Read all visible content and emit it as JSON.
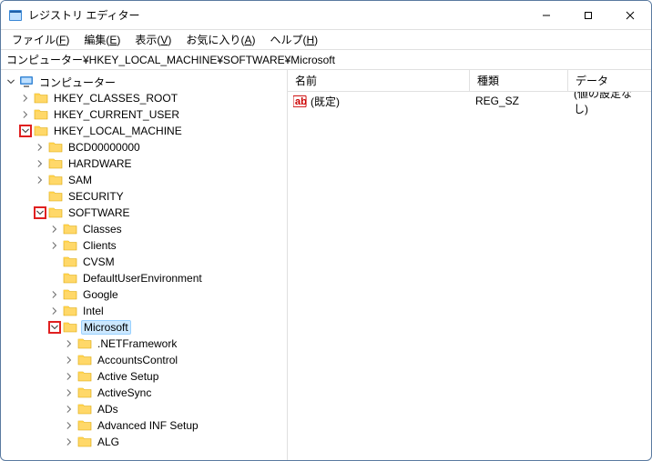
{
  "window": {
    "title": "レジストリ エディター"
  },
  "menu": {
    "file": {
      "label": "ファイル",
      "key": "F"
    },
    "edit": {
      "label": "編集",
      "key": "E"
    },
    "view": {
      "label": "表示",
      "key": "V"
    },
    "fav": {
      "label": "お気に入り",
      "key": "A"
    },
    "help": {
      "label": "ヘルプ",
      "key": "H"
    }
  },
  "address": "コンピューター¥HKEY_LOCAL_MACHINE¥SOFTWARE¥Microsoft",
  "tree": [
    {
      "indent": 0,
      "expander": "open",
      "highlight": false,
      "icon": "computer",
      "label": "コンピューター"
    },
    {
      "indent": 1,
      "expander": "closed",
      "highlight": false,
      "icon": "folder",
      "label": "HKEY_CLASSES_ROOT"
    },
    {
      "indent": 1,
      "expander": "closed",
      "highlight": false,
      "icon": "folder",
      "label": "HKEY_CURRENT_USER"
    },
    {
      "indent": 1,
      "expander": "open",
      "highlight": true,
      "icon": "folder",
      "label": "HKEY_LOCAL_MACHINE"
    },
    {
      "indent": 2,
      "expander": "closed",
      "highlight": false,
      "icon": "folder",
      "label": "BCD00000000"
    },
    {
      "indent": 2,
      "expander": "closed",
      "highlight": false,
      "icon": "folder",
      "label": "HARDWARE"
    },
    {
      "indent": 2,
      "expander": "closed",
      "highlight": false,
      "icon": "folder",
      "label": "SAM"
    },
    {
      "indent": 2,
      "expander": "none",
      "highlight": false,
      "icon": "folder",
      "label": "SECURITY"
    },
    {
      "indent": 2,
      "expander": "open",
      "highlight": true,
      "icon": "folder",
      "label": "SOFTWARE"
    },
    {
      "indent": 3,
      "expander": "closed",
      "highlight": false,
      "icon": "folder",
      "label": "Classes"
    },
    {
      "indent": 3,
      "expander": "closed",
      "highlight": false,
      "icon": "folder",
      "label": "Clients"
    },
    {
      "indent": 3,
      "expander": "none",
      "highlight": false,
      "icon": "folder",
      "label": "CVSM"
    },
    {
      "indent": 3,
      "expander": "none",
      "highlight": false,
      "icon": "folder",
      "label": "DefaultUserEnvironment"
    },
    {
      "indent": 3,
      "expander": "closed",
      "highlight": false,
      "icon": "folder",
      "label": "Google"
    },
    {
      "indent": 3,
      "expander": "closed",
      "highlight": false,
      "icon": "folder",
      "label": "Intel"
    },
    {
      "indent": 3,
      "expander": "open",
      "highlight": true,
      "icon": "folder",
      "label": "Microsoft",
      "selected": true
    },
    {
      "indent": 4,
      "expander": "closed",
      "highlight": false,
      "icon": "folder",
      "label": ".NETFramework"
    },
    {
      "indent": 4,
      "expander": "closed",
      "highlight": false,
      "icon": "folder",
      "label": "AccountsControl"
    },
    {
      "indent": 4,
      "expander": "closed",
      "highlight": false,
      "icon": "folder",
      "label": "Active Setup"
    },
    {
      "indent": 4,
      "expander": "closed",
      "highlight": false,
      "icon": "folder",
      "label": "ActiveSync"
    },
    {
      "indent": 4,
      "expander": "closed",
      "highlight": false,
      "icon": "folder",
      "label": "ADs"
    },
    {
      "indent": 4,
      "expander": "closed",
      "highlight": false,
      "icon": "folder",
      "label": "Advanced INF Setup"
    },
    {
      "indent": 4,
      "expander": "closed",
      "highlight": false,
      "icon": "folder",
      "label": "ALG"
    }
  ],
  "columns": {
    "name": "名前",
    "type": "種類",
    "data": "データ"
  },
  "rows": [
    {
      "name": "(既定)",
      "type": "REG_SZ",
      "data": "(値の設定なし)"
    }
  ]
}
